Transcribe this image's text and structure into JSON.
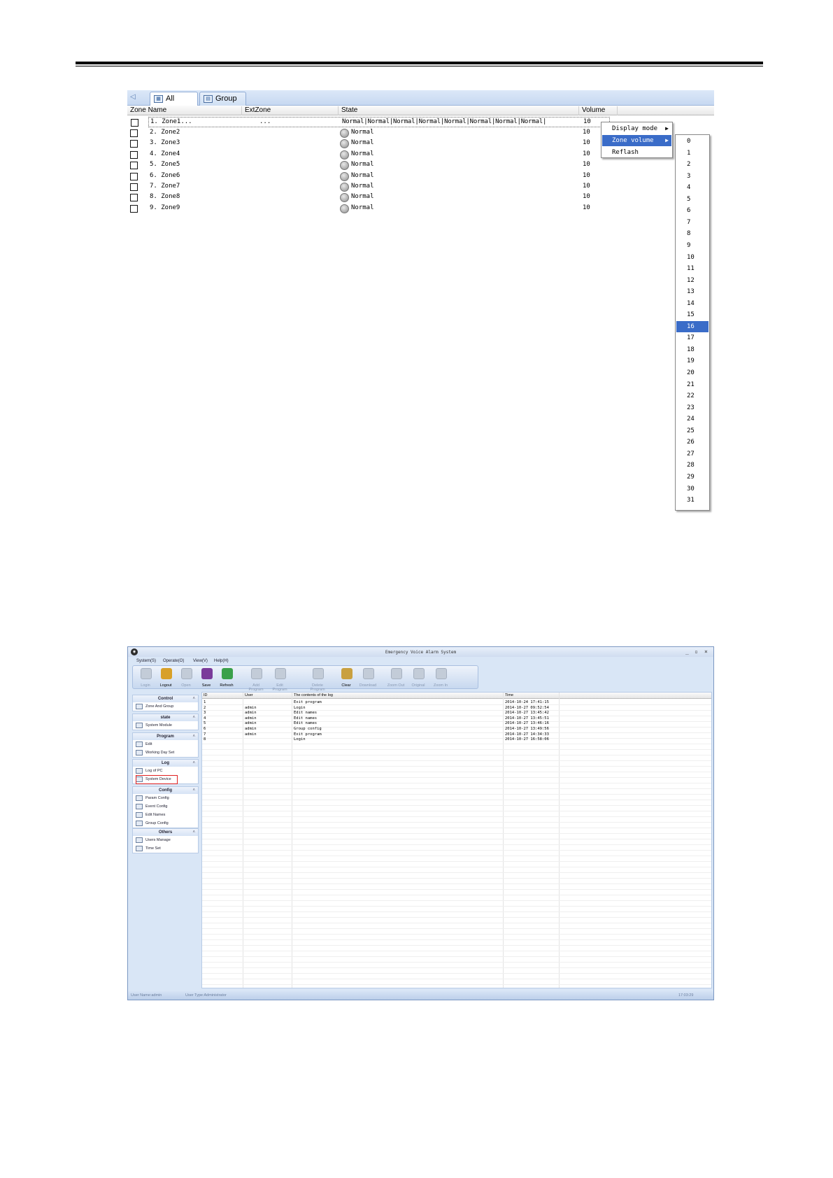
{
  "zone_panel": {
    "tabs": [
      {
        "label": "All Zone"
      },
      {
        "label": "Group"
      }
    ],
    "columns": [
      "Zone Name",
      "ExtZone",
      "State",
      "Volume"
    ],
    "first_row": {
      "name": "1. Zone1...",
      "ext": "...",
      "state": "Normal|Normal|Normal|Normal|Normal|Normal|Normal|Normal|",
      "volume": "10"
    },
    "rows": [
      {
        "name": "2. Zone2",
        "state": "Normal",
        "volume": "10"
      },
      {
        "name": "3. Zone3",
        "state": "Normal",
        "volume": "10"
      },
      {
        "name": "4. Zone4",
        "state": "Normal",
        "volume": "10"
      },
      {
        "name": "5. Zone5",
        "state": "Normal",
        "volume": "10"
      },
      {
        "name": "6. Zone6",
        "state": "Normal",
        "volume": "10"
      },
      {
        "name": "7. Zone7",
        "state": "Normal",
        "volume": "10"
      },
      {
        "name": "8. Zone8",
        "state": "Normal",
        "volume": "10"
      },
      {
        "name": "9. Zone9",
        "state": "Normal",
        "volume": "10"
      }
    ],
    "context_menu": [
      "Display mode",
      "Zone volume",
      "Reflash"
    ],
    "volume_options": [
      "0",
      "1",
      "2",
      "3",
      "4",
      "5",
      "6",
      "7",
      "8",
      "9",
      "10",
      "11",
      "12",
      "13",
      "14",
      "15",
      "16",
      "17",
      "18",
      "19",
      "20",
      "21",
      "22",
      "23",
      "24",
      "25",
      "26",
      "27",
      "28",
      "29",
      "30",
      "31"
    ],
    "selected_volume": "16",
    "highlight_color": "#3a6cc8"
  },
  "app": {
    "title": "Emergency Voice Alarm System",
    "window_controls": [
      "_",
      "▫",
      "×"
    ],
    "menu": [
      "System(S)",
      "Operate(O)",
      "View(V)",
      "Help(H)"
    ],
    "toolbar": [
      {
        "label": "Login",
        "icon": "key-icon",
        "enabled": false
      },
      {
        "label": "Logout",
        "icon": "logout-icon",
        "enabled": true
      },
      {
        "label": "Open",
        "icon": "open-icon",
        "enabled": false
      },
      {
        "label": "Save",
        "icon": "floppy-icon",
        "enabled": true
      },
      {
        "label": "Refresh",
        "icon": "refresh-icon",
        "enabled": true
      },
      {
        "label": "Add Program",
        "icon": "add-clock-icon",
        "enabled": false
      },
      {
        "label": "Edit Program",
        "icon": "edit-clock-icon",
        "enabled": false
      },
      {
        "label": "Delete Program",
        "icon": "delete-clock-icon",
        "enabled": false
      },
      {
        "label": "Clear",
        "icon": "broom-icon",
        "enabled": true
      },
      {
        "label": "Download",
        "icon": "download-icon",
        "enabled": false
      },
      {
        "label": "Zoom Out",
        "icon": "zoom-out-icon",
        "enabled": false
      },
      {
        "label": "Original",
        "icon": "zoom-original-icon",
        "enabled": false
      },
      {
        "label": "Zoom In",
        "icon": "zoom-in-icon",
        "enabled": false
      }
    ],
    "sidebar": [
      {
        "header": "Control",
        "items": [
          "Zone And Group"
        ]
      },
      {
        "header": "state",
        "items": [
          "System Module"
        ]
      },
      {
        "header": "Program",
        "items": [
          "Edit",
          "Working Day Set"
        ]
      },
      {
        "header": "Log",
        "items": [
          "Log of PC",
          "System Device"
        ]
      },
      {
        "header": "Config",
        "items": [
          "Param Config",
          "Event Config",
          "Edit Names",
          "Group Config"
        ]
      },
      {
        "header": "Others",
        "items": [
          "Users Manage",
          "Time Set"
        ]
      }
    ],
    "log": {
      "columns": [
        "ID",
        "User",
        "The contents of the log",
        "Time"
      ],
      "rows": [
        {
          "id": "1",
          "user": "",
          "content": "Exit program",
          "time": "2014-10-24 17:41:15"
        },
        {
          "id": "2",
          "user": "admin",
          "content": "Login",
          "time": "2014-10-27 09:52:54"
        },
        {
          "id": "3",
          "user": "admin",
          "content": "Edit names",
          "time": "2014-10-27 13:45:42"
        },
        {
          "id": "4",
          "user": "admin",
          "content": "Edit names",
          "time": "2014-10-27 13:45:51"
        },
        {
          "id": "5",
          "user": "admin",
          "content": "Edit names",
          "time": "2014-10-27 13:46:16"
        },
        {
          "id": "6",
          "user": "admin",
          "content": "Group config",
          "time": "2014-10-27 13:49:56"
        },
        {
          "id": "7",
          "user": "admin",
          "content": "Exit program",
          "time": "2014-10-27 14:34:33"
        },
        {
          "id": "8",
          "user": "",
          "content": "Login",
          "time": "2014-10-27 16:58:06"
        }
      ]
    },
    "status": {
      "user_name": "User Name:admin",
      "user_type": "User Type:Administrator",
      "clock": "17:03:29"
    }
  }
}
